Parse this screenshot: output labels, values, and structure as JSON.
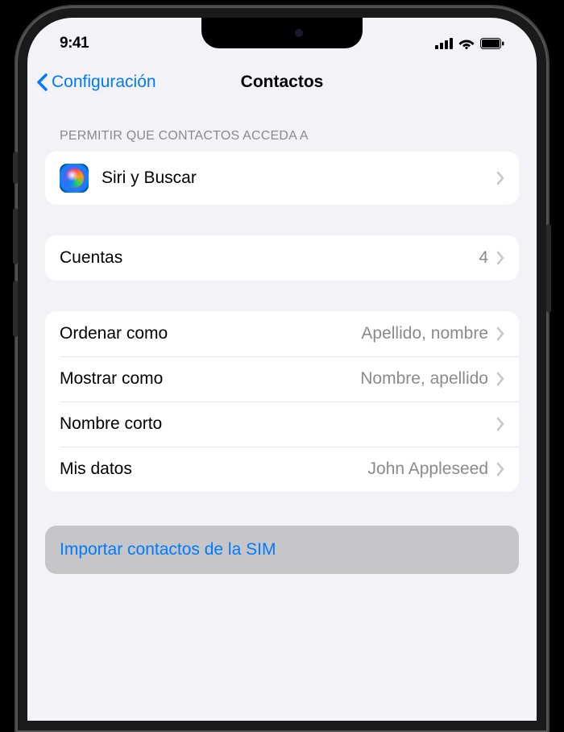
{
  "status": {
    "time": "9:41"
  },
  "nav": {
    "back_label": "Configuración",
    "title": "Contactos"
  },
  "section1": {
    "header": "Permitir que Contactos acceda a",
    "siri_label": "Siri y Buscar"
  },
  "section2": {
    "accounts_label": "Cuentas",
    "accounts_value": "4"
  },
  "section3": {
    "sort_label": "Ordenar como",
    "sort_value": "Apellido, nombre",
    "display_label": "Mostrar como",
    "display_value": "Nombre, apellido",
    "short_label": "Nombre corto",
    "mycard_label": "Mis datos",
    "mycard_value": "John Appleseed"
  },
  "section4": {
    "import_label": "Importar contactos de la SIM"
  }
}
